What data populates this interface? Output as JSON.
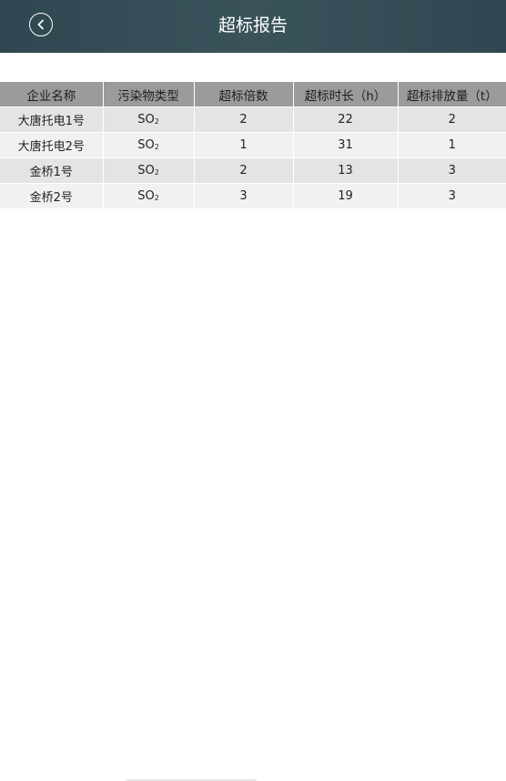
{
  "header": {
    "title": "超标报告",
    "back_icon": "chevron-left-icon"
  },
  "table": {
    "columns": [
      "企业名称",
      "污染物类型",
      "超标倍数",
      "超标时长（h）",
      "超标排放量（t）"
    ],
    "rows": [
      {
        "company": "大唐托电1号",
        "pollutant": "SO",
        "pollutant_sub": "2",
        "multiple": "2",
        "duration": "22",
        "amount": "2"
      },
      {
        "company": "大唐托电2号",
        "pollutant": "SO",
        "pollutant_sub": "2",
        "multiple": "1",
        "duration": "31",
        "amount": "1"
      },
      {
        "company": "金桥1号",
        "pollutant": "SO",
        "pollutant_sub": "2",
        "multiple": "2",
        "duration": "13",
        "amount": "3"
      },
      {
        "company": "金桥2号",
        "pollutant": "SO",
        "pollutant_sub": "2",
        "multiple": "3",
        "duration": "19",
        "amount": "3"
      }
    ]
  },
  "colors": {
    "nav_background": "#34505a",
    "header_row": "#9a9b9d",
    "row_odd": "#e4e4e6",
    "row_even": "#f1f1f3"
  }
}
